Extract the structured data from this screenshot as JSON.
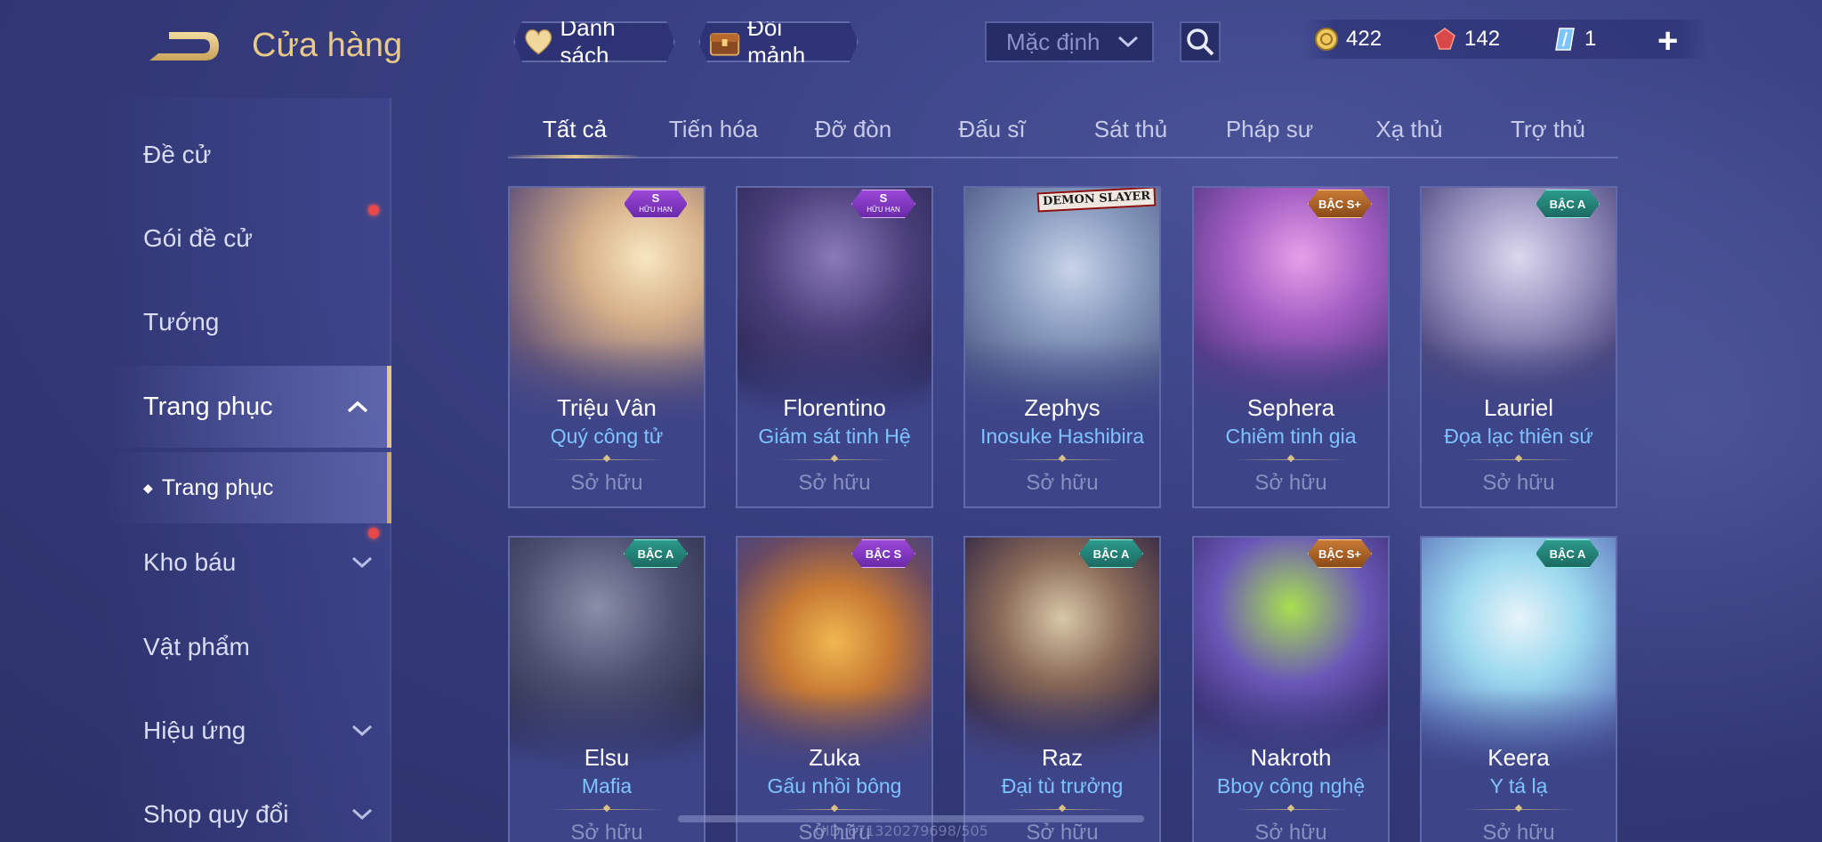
{
  "header": {
    "title": "Cửa hàng",
    "list_label": "Danh sách",
    "fragment_label": "Đổi mảnh",
    "sort_value": "Mặc định"
  },
  "currency": {
    "gold": "422",
    "ruby": "142",
    "voucher": "1"
  },
  "sidebar": {
    "items": [
      {
        "label": "Đề cử"
      },
      {
        "label": "Gói đề cử"
      },
      {
        "label": "Tướng"
      },
      {
        "label": "Trang phục"
      },
      {
        "label": "Kho báu"
      },
      {
        "label": "Vật phẩm"
      },
      {
        "label": "Hiệu ứng"
      },
      {
        "label": "Shop quy đổi"
      }
    ],
    "sub_item": "Trang phục"
  },
  "tabs": [
    "Tất cả",
    "Tiến hóa",
    "Đỡ đòn",
    "Đấu sĩ",
    "Sát thủ",
    "Pháp sư",
    "Xạ thủ",
    "Trợ thủ"
  ],
  "cards": [
    {
      "hero": "Triệu Vân",
      "skin": "Quý công tử",
      "status": "Sở hữu",
      "badge": "S",
      "badge_sub": "HỮU HẠN"
    },
    {
      "hero": "Florentino",
      "skin": "Giám sát tinh Hệ",
      "status": "Sở hữu",
      "badge": "S",
      "badge_sub": "HỮU HẠN"
    },
    {
      "hero": "Zephys",
      "skin": "Inosuke Hashibira",
      "status": "Sở hữu",
      "badge": "DEMON SLAYER",
      "badge_sub": ""
    },
    {
      "hero": "Sephera",
      "skin": "Chiêm tinh gia",
      "status": "Sở hữu",
      "badge": "BẬC S+",
      "badge_sub": ""
    },
    {
      "hero": "Lauriel",
      "skin": "Đọa lạc thiên sứ",
      "status": "Sở hữu",
      "badge": "BẬC A",
      "badge_sub": ""
    },
    {
      "hero": "Elsu",
      "skin": "Mafia",
      "status": "Sở hữu",
      "badge": "BẬC A",
      "badge_sub": ""
    },
    {
      "hero": "Zuka",
      "skin": "Gấu nhồi bông",
      "status": "Sở hữu",
      "badge": "BẬC S",
      "badge_sub": ""
    },
    {
      "hero": "Raz",
      "skin": "Đại tù trưởng",
      "status": "Sở hữu",
      "badge": "BẬC A",
      "badge_sub": ""
    },
    {
      "hero": "Nakroth",
      "skin": "Bboy công nghệ",
      "status": "Sở hữu",
      "badge": "BẬC S+",
      "badge_sub": ""
    },
    {
      "hero": "Keera",
      "skin": "Y tá lạ",
      "status": "Sở hữu",
      "badge": "BẬC A",
      "badge_sub": ""
    }
  ],
  "footer": {
    "uid": "UID_671320279698/505"
  },
  "colors": {
    "accent_gold": "#e2c78a",
    "skin_name_blue": "#7ec4ff",
    "notification_red": "#e74848",
    "background": "#3a4184"
  }
}
